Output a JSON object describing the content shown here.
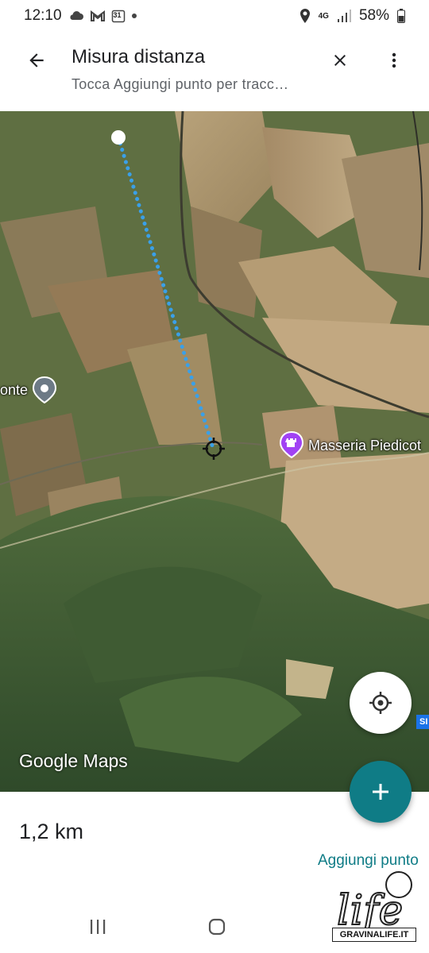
{
  "status_bar": {
    "time": "12:10",
    "left_icons": [
      "cloud-icon",
      "gmail-icon",
      "calendar-icon",
      "dot-icon"
    ],
    "calendar_day": "31",
    "network": "4G",
    "battery": "58%",
    "right_icons": [
      "location-icon",
      "signal-icon",
      "battery-icon"
    ]
  },
  "app_bar": {
    "title": "Misura distanza",
    "subtitle": "Tocca Aggiungi punto per tracc…",
    "icons": [
      "back-arrow-icon",
      "close-icon",
      "more-vert-icon"
    ]
  },
  "map": {
    "poi_left_label": "onte",
    "poi_right_label": "Masseria Piedicot",
    "logo_text": "Google Maps",
    "road_shield": "SI",
    "icons": [
      "pin-icon",
      "castle-icon",
      "crosshair-icon",
      "my-location-icon"
    ]
  },
  "measurement": {
    "distance": "1,2 km",
    "add_point_label": "Aggiungi punto"
  },
  "fab": {
    "icon": "plus-icon"
  },
  "nav_bar": {
    "icons": [
      "recent-apps-icon",
      "home-icon"
    ]
  },
  "watermark": {
    "brand": "life",
    "site": "GRAVINALIFE.IT"
  },
  "colors": {
    "accent": "#0f7c86",
    "route_dots": "#3aa0e8",
    "poi_purple": "#a142f4"
  }
}
